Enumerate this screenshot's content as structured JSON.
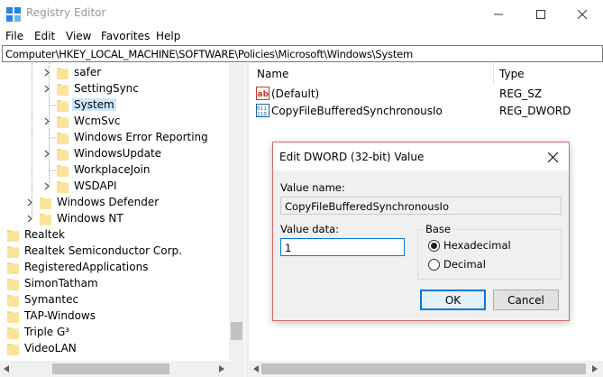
{
  "window": {
    "title": "Registry Editor"
  },
  "menu": {
    "items": [
      "File",
      "Edit",
      "View",
      "Favorites",
      "Help"
    ]
  },
  "address": {
    "path": "Computer\\HKEY_LOCAL_MACHINE\\SOFTWARE\\Policies\\Microsoft\\Windows\\System"
  },
  "tree": {
    "items": [
      {
        "label": "safer",
        "expandable": true
      },
      {
        "label": "SettingSync",
        "expandable": true
      },
      {
        "label": "System",
        "expandable": false,
        "selected": true
      },
      {
        "label": "WcmSvc",
        "expandable": true
      },
      {
        "label": "Windows Error Reporting",
        "expandable": false
      },
      {
        "label": "WindowsUpdate",
        "expandable": true
      },
      {
        "label": "WorkplaceJoin",
        "expandable": false
      },
      {
        "label": "WSDAPI",
        "expandable": true
      },
      {
        "label": "Windows Defender",
        "expandable": true
      },
      {
        "label": "Windows NT",
        "expandable": true
      },
      {
        "label": "Realtek",
        "expandable": false
      },
      {
        "label": "Realtek Semiconductor Corp.",
        "expandable": false
      },
      {
        "label": "RegisteredApplications",
        "expandable": false
      },
      {
        "label": "SimonTatham",
        "expandable": false
      },
      {
        "label": "Symantec",
        "expandable": false
      },
      {
        "label": "TAP-Windows",
        "expandable": false
      },
      {
        "label": "Triple G³",
        "expandable": false
      },
      {
        "label": "VideoLAN",
        "expandable": false
      }
    ]
  },
  "values": {
    "headers": {
      "name": "Name",
      "type": "Type"
    },
    "rows": [
      {
        "name": "(Default)",
        "type": "REG_SZ",
        "icon": "string-value-icon"
      },
      {
        "name": "CopyFileBufferedSynchronousIo",
        "type": "REG_DWORD",
        "icon": "binary-value-icon"
      }
    ]
  },
  "dialog": {
    "title": "Edit DWORD (32-bit) Value",
    "value_name_label": "Value name:",
    "value_name": "CopyFileBufferedSynchronousIo",
    "value_data_label": "Value data:",
    "value_data": "1",
    "base_label": "Base",
    "base_options": [
      "Hexadecimal",
      "Decimal"
    ],
    "base_selected": "Hexadecimal",
    "ok_label": "OK",
    "cancel_label": "Cancel"
  },
  "colors": {
    "selection": "#cce8ff",
    "folder": "#f8d775",
    "dialog_border": "#d36b6b",
    "accent": "#0078d7"
  }
}
